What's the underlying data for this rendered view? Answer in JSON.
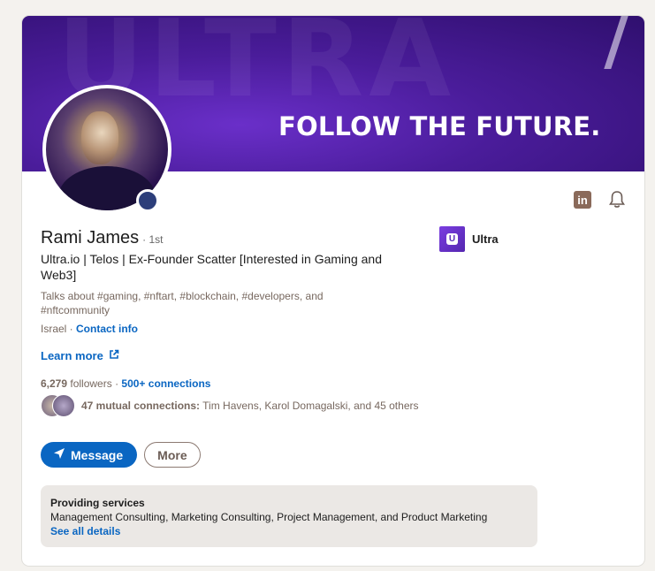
{
  "banner": {
    "tagline": "FOLLOW THE FUTURE."
  },
  "profile": {
    "name": "Rami James",
    "degree": "· 1st",
    "headline": "Ultra.io | Telos | Ex-Founder Scatter [Interested in Gaming and Web3]",
    "talks_about": "Talks about #gaming, #nftart, #blockchain, #developers, and #nftcommunity",
    "location": "Israel",
    "location_sep": " · ",
    "contact_info": "Contact info",
    "learn_more": "Learn more",
    "followers_count": "6,279",
    "followers_label": "followers",
    "followers_sep": " · ",
    "connections": "500+ connections",
    "mutual_bold": "47 mutual connections:",
    "mutual_names": "Tim Havens, Karol Domagalski, and 45 others"
  },
  "company": {
    "name": "Ultra",
    "logo_letter": "U"
  },
  "actions": {
    "message": "Message",
    "more": "More"
  },
  "services": {
    "title": "Providing services",
    "list": "Management Consulting, Marketing Consulting, Project Management, and Product Marketing",
    "see_all": "See all details"
  },
  "icons": {
    "linkedin": "linkedin-icon",
    "bell": "bell-icon",
    "send": "send-icon",
    "external": "external-link-icon"
  },
  "colors": {
    "brand_blue": "#0a66c2",
    "banner_purple": "#4a1c9a",
    "card_bg": "#ffffff",
    "page_bg": "#f4f2ee"
  }
}
